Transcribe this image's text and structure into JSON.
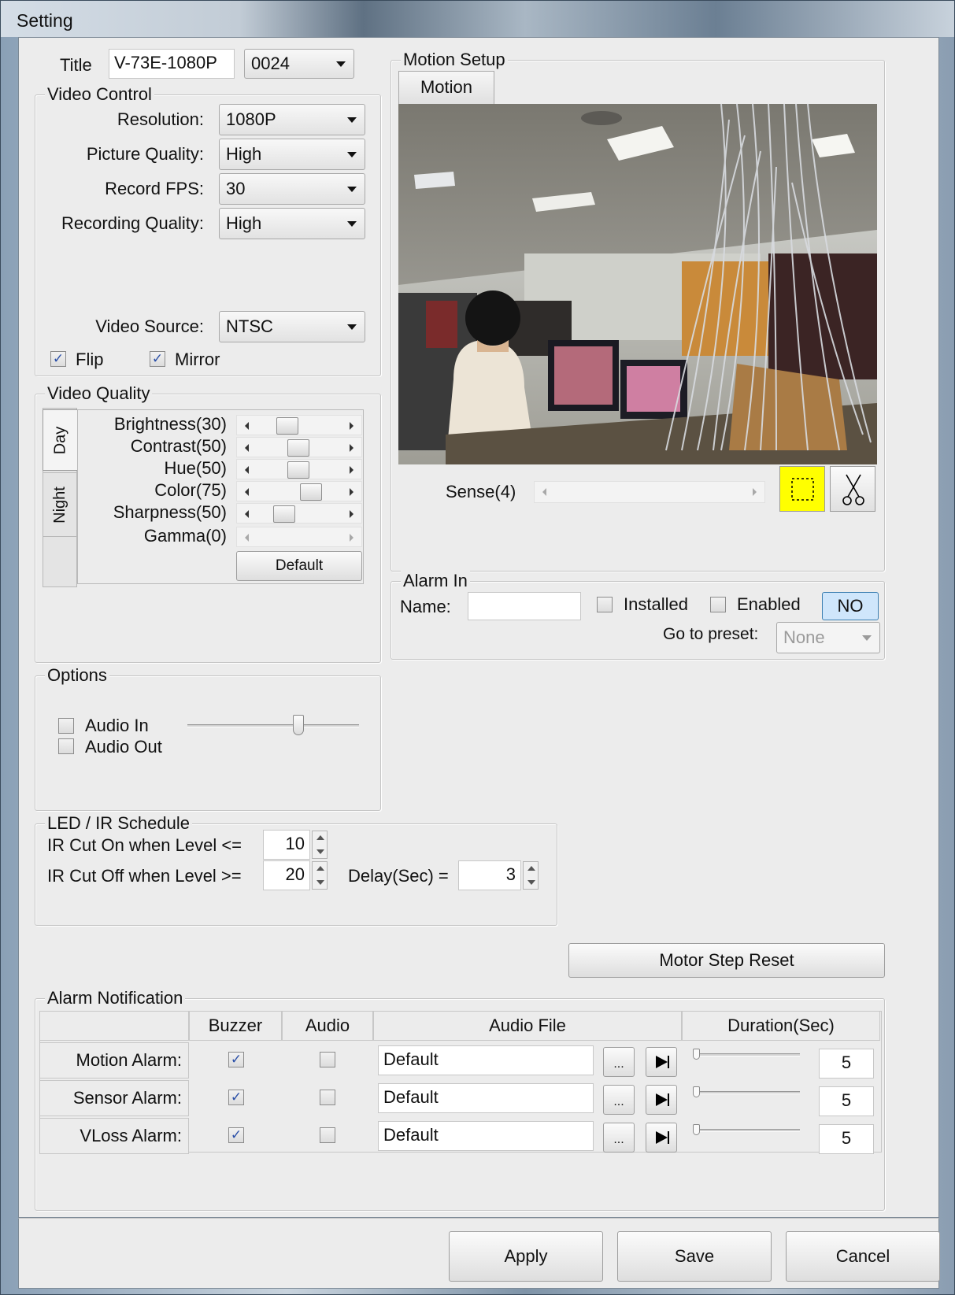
{
  "window": {
    "title": "Setting"
  },
  "header": {
    "title_label": "Title",
    "title_value": "V-73E-1080P",
    "channel_value": "0024"
  },
  "video_control": {
    "label": "Video Control",
    "resolution_label": "Resolution:",
    "resolution_value": "1080P",
    "picture_quality_label": "Picture Quality:",
    "picture_quality_value": "High",
    "record_fps_label": "Record FPS:",
    "record_fps_value": "30",
    "recording_quality_label": "Recording Quality:",
    "recording_quality_value": "High",
    "video_source_label": "Video Source:",
    "video_source_value": "NTSC",
    "flip_label": "Flip",
    "flip_checked": true,
    "mirror_label": "Mirror",
    "mirror_checked": true
  },
  "video_quality": {
    "label": "Video Quality",
    "tabs": [
      "Day",
      "Night"
    ],
    "sliders": [
      {
        "label": "Brightness(30)",
        "value": 30
      },
      {
        "label": "Contrast(50)",
        "value": 50
      },
      {
        "label": "Hue(50)",
        "value": 50
      },
      {
        "label": "Color(75)",
        "value": 75
      },
      {
        "label": "Sharpness(50)",
        "value": 50
      },
      {
        "label": "Gamma(0)",
        "value": 0
      }
    ],
    "default_button": "Default"
  },
  "options": {
    "label": "Options",
    "audio_in_label": "Audio In",
    "audio_out_label": "Audio Out",
    "volume_level": 0.66
  },
  "led_ir": {
    "label": "LED / IR Schedule",
    "cut_on_label": "IR Cut On when Level <=",
    "cut_on_value": "10",
    "cut_off_label": "IR Cut Off when Level >=",
    "cut_off_value": "20",
    "delay_label": "Delay(Sec) =",
    "delay_value": "3"
  },
  "motion_setup": {
    "label": "Motion Setup",
    "tab": "Motion",
    "sense_label": "Sense(4)"
  },
  "alarm_in": {
    "label": "Alarm In",
    "name_label": "Name:",
    "name_value": "",
    "installed_label": "Installed",
    "enabled_label": "Enabled",
    "no_button": "NO",
    "preset_label": "Go to preset:",
    "preset_value": "None"
  },
  "motor_step_reset": "Motor Step Reset",
  "alarm_notification": {
    "label": "Alarm Notification",
    "headers": [
      "Buzzer",
      "Audio",
      "Audio File",
      "Duration(Sec)"
    ],
    "rows": [
      {
        "name": "Motion Alarm:",
        "buzzer": true,
        "audio": false,
        "file": "Default",
        "duration": "5"
      },
      {
        "name": "Sensor Alarm:",
        "buzzer": true,
        "audio": false,
        "file": "Default",
        "duration": "5"
      },
      {
        "name": "VLoss Alarm:",
        "buzzer": true,
        "audio": false,
        "file": "Default",
        "duration": "5"
      }
    ],
    "browse_label": "..."
  },
  "footer": {
    "apply": "Apply",
    "save": "Save",
    "cancel": "Cancel"
  },
  "colors": {
    "draw_tool_bg": "#ffff00",
    "no_button_bg": "#cfe6fb"
  }
}
